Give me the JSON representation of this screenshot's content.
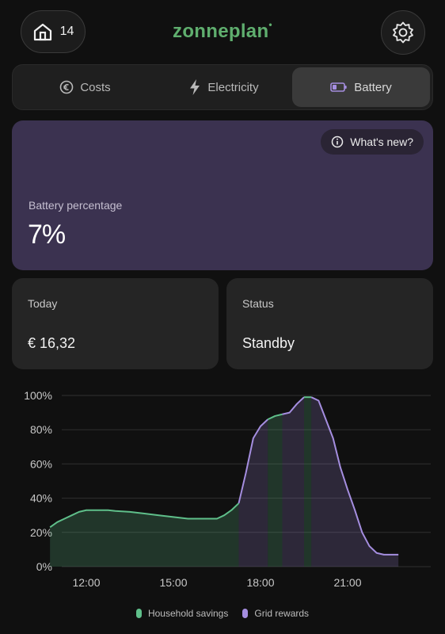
{
  "header": {
    "home_count": "14",
    "logo_text": "zonneplan",
    "logo_color": "#5fae6e"
  },
  "tabs": [
    {
      "label": "Costs",
      "icon": "euro-circle-icon"
    },
    {
      "label": "Electricity",
      "icon": "lightning-icon"
    },
    {
      "label": "Battery",
      "icon": "battery-icon",
      "active": true
    }
  ],
  "battery_card": {
    "whats_new_label": "What's new?",
    "label": "Battery percentage",
    "value": "7%",
    "background": "#3b3250"
  },
  "today_card": {
    "label": "Today",
    "value": "€ 16,32"
  },
  "status_card": {
    "label": "Status",
    "value": "Standby"
  },
  "chart_data": {
    "type": "area",
    "xlabel": "",
    "ylabel": "",
    "x_ticks": [
      "12:00",
      "15:00",
      "18:00",
      "21:00"
    ],
    "y_ticks": [
      "0%",
      "20%",
      "40%",
      "60%",
      "80%",
      "100%"
    ],
    "ylim": [
      0,
      100
    ],
    "xlim_hours": [
      10.5,
      23.5
    ],
    "grid": true,
    "legend_placement": "bottom-center",
    "series": [
      {
        "name": "Household savings",
        "color": "#5fbf8a"
      },
      {
        "name": "Grid rewards",
        "color": "#a58ee0"
      }
    ],
    "x": [
      "10:45",
      "11:00",
      "11:15",
      "11:30",
      "11:45",
      "12:00",
      "12:15",
      "12:30",
      "12:45",
      "13:00",
      "13:30",
      "14:00",
      "14:30",
      "15:00",
      "15:30",
      "16:00",
      "16:30",
      "16:45",
      "17:00",
      "17:15",
      "17:30",
      "17:45",
      "18:00",
      "18:15",
      "18:30",
      "18:45",
      "19:00",
      "19:15",
      "19:30",
      "19:45",
      "20:00",
      "20:15",
      "20:30",
      "20:45",
      "21:00",
      "21:15",
      "21:30",
      "21:45",
      "22:00",
      "22:15",
      "22:30",
      "22:45"
    ],
    "values": [
      23,
      26,
      28,
      30,
      32,
      33,
      33,
      33,
      33,
      32.5,
      32,
      31,
      30,
      29,
      28,
      28,
      28,
      30,
      33,
      37,
      55,
      75,
      82,
      86,
      88,
      89,
      90,
      95,
      99,
      99,
      97,
      86,
      75,
      58,
      45,
      33,
      20,
      12,
      8,
      7,
      7,
      7
    ],
    "segments": [
      {
        "series": "Household savings",
        "from": "10:45",
        "to": "17:15"
      },
      {
        "series": "Grid rewards",
        "from": "17:15",
        "to": "18:15"
      },
      {
        "series": "Household savings",
        "from": "18:15",
        "to": "18:45"
      },
      {
        "series": "Grid rewards",
        "from": "18:45",
        "to": "19:30"
      },
      {
        "series": "Household savings",
        "from": "19:30",
        "to": "19:45"
      },
      {
        "series": "Grid rewards",
        "from": "19:45",
        "to": "22:45"
      }
    ]
  }
}
